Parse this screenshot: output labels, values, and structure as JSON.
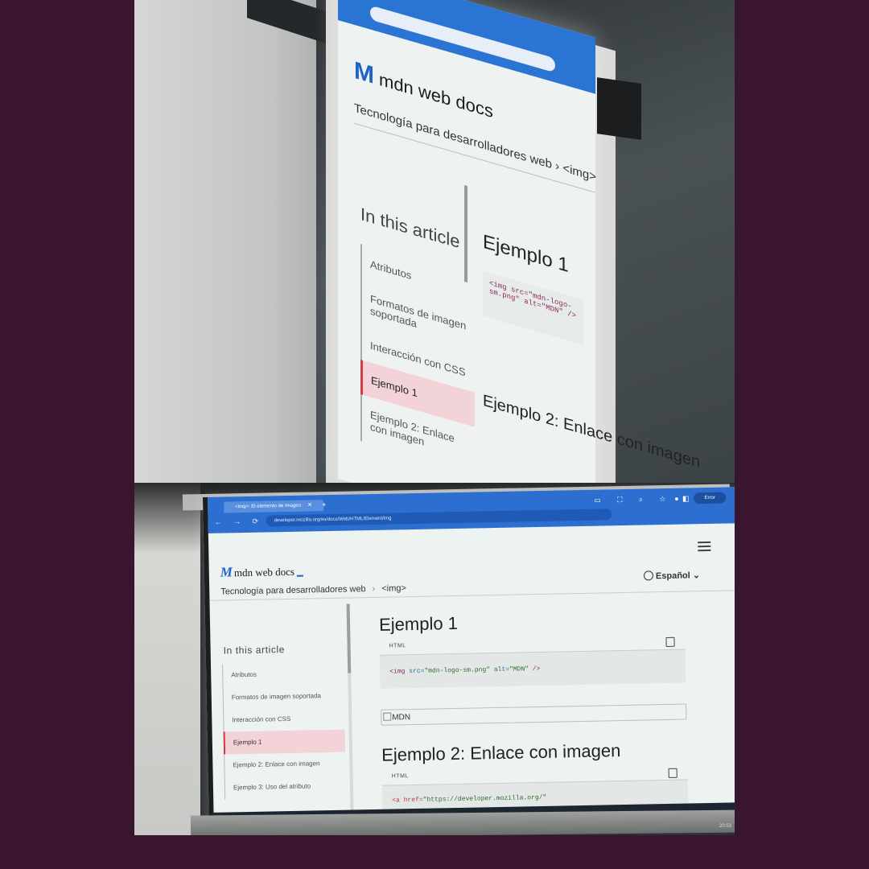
{
  "top_photo": {
    "breadcrumb": "Tecnología para desarrolladores web",
    "crumb_tag": "<img>",
    "toc_title": "In this article",
    "toc_items": [
      "Atributos",
      "Formatos de imagen soportada",
      "Interacción con CSS",
      "Ejemplo 1",
      "Ejemplo 2: Enlace con imagen"
    ],
    "heading_1": "Ejemplo 1",
    "code_snippet": "<img src=\"mdn-logo-sm.png\" alt=\"MDN\" />",
    "heading_2": "Ejemplo 2: Enlace con imagen",
    "logo_text": "mdn web docs"
  },
  "browser": {
    "tab_title": "<img>: El elemento de Imagen",
    "url": "developer.mozilla.org/es/docs/Web/HTML/Element/img",
    "error_label": "Error",
    "nav_glyphs": "← → ⟳",
    "tool_glyphs": "▭ ⛶ ⌕ ☆ ◧"
  },
  "page": {
    "logo_text": "mdn web docs",
    "breadcrumb_root": "Tecnología para desarrolladores web",
    "breadcrumb_sep": "›",
    "breadcrumb_leaf": "<img>",
    "language": "Español",
    "toc_title": "In this article",
    "toc_items": [
      {
        "label": "Atributos"
      },
      {
        "label": "Formatos de imagen soportada"
      },
      {
        "label": "Interacción con CSS"
      },
      {
        "label": "Ejemplo 1",
        "active": true
      },
      {
        "label": "Ejemplo 2: Enlace con imagen"
      },
      {
        "label": "Ejemplo 3: Uso del atributo"
      }
    ],
    "example1_heading": "Ejemplo 1",
    "example1_lang": "HTML",
    "example1_code": {
      "open": "<img ",
      "attr1": "src=",
      "val1": "\"mdn-logo-sm.png\"",
      "attr2": " alt=",
      "val2": "\"MDN\"",
      "close": " />"
    },
    "broken_image_alt": "MDN",
    "example2_heading": "Ejemplo 2: Enlace con imagen",
    "example2_lang": "HTML",
    "example2_code_tag": "<a href=",
    "example2_code_val": "\"https://developer.mozilla.org/\""
  },
  "taskbar": {
    "clock": "20:53"
  },
  "colors": {
    "background": "#3a1530",
    "browser_chrome": "#2d6fd0",
    "mdn_blue": "#1f62c9",
    "toc_active": "#f4d3d8"
  }
}
